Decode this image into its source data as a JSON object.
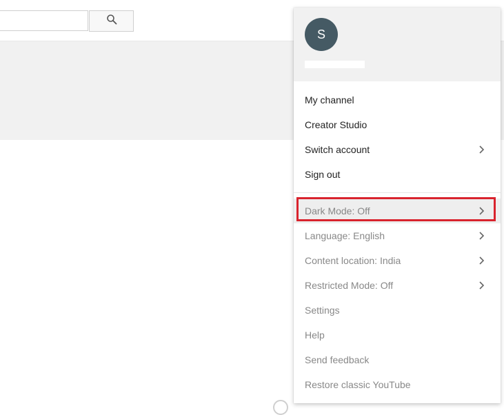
{
  "search": {
    "value": "",
    "icon": "search-icon"
  },
  "account": {
    "avatar_initial": "S"
  },
  "menu": {
    "account_items": [
      {
        "label": "My channel",
        "has_submenu": false
      },
      {
        "label": "Creator Studio",
        "has_submenu": false
      },
      {
        "label": "Switch account",
        "has_submenu": true
      },
      {
        "label": "Sign out",
        "has_submenu": false
      }
    ],
    "settings_items": [
      {
        "label": "Dark Mode: Off",
        "has_submenu": true,
        "highlighted": true
      },
      {
        "label": "Language: English",
        "has_submenu": true
      },
      {
        "label": "Content location: India",
        "has_submenu": true
      },
      {
        "label": "Restricted Mode: Off",
        "has_submenu": true
      },
      {
        "label": "Settings",
        "has_submenu": false
      },
      {
        "label": "Help",
        "has_submenu": false
      },
      {
        "label": "Send feedback",
        "has_submenu": false
      },
      {
        "label": "Restore classic YouTube",
        "has_submenu": false
      }
    ]
  },
  "colors": {
    "avatar_bg": "#455a64",
    "highlight_border": "#d9232d",
    "header_bg": "#f1f1f1"
  }
}
